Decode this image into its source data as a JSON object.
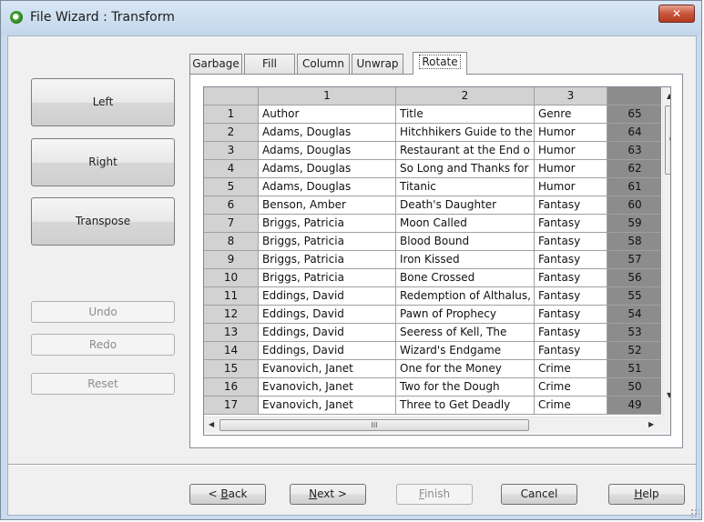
{
  "window": {
    "title": "File Wizard : Transform",
    "close_symbol": "✕"
  },
  "side_buttons": {
    "left": "Left",
    "right": "Right",
    "transpose": "Transpose"
  },
  "history_buttons": {
    "undo": "Undo",
    "redo": "Redo",
    "reset": "Reset"
  },
  "tabs": [
    {
      "label": "Garbage"
    },
    {
      "label": "Fill"
    },
    {
      "label": "Column"
    },
    {
      "label": "Unwrap"
    },
    {
      "label": "Rotate",
      "active": true
    }
  ],
  "grid": {
    "columns": [
      "1",
      "2",
      "3",
      ""
    ],
    "rows": [
      [
        "1",
        "Author",
        "Title",
        "Genre",
        "65"
      ],
      [
        "2",
        "Adams, Douglas",
        "Hitchhikers Guide to the",
        "Humor",
        "64"
      ],
      [
        "3",
        "Adams, Douglas",
        "Restaurant at the End o",
        "Humor",
        "63"
      ],
      [
        "4",
        "Adams, Douglas",
        "So Long and Thanks for",
        "Humor",
        "62"
      ],
      [
        "5",
        "Adams, Douglas",
        "Titanic",
        "Humor",
        "61"
      ],
      [
        "6",
        "Benson, Amber",
        "Death's Daughter",
        "Fantasy",
        "60"
      ],
      [
        "7",
        "Briggs, Patricia",
        "Moon Called",
        "Fantasy",
        "59"
      ],
      [
        "8",
        "Briggs, Patricia",
        "Blood Bound",
        "Fantasy",
        "58"
      ],
      [
        "9",
        "Briggs, Patricia",
        "Iron Kissed",
        "Fantasy",
        "57"
      ],
      [
        "10",
        "Briggs, Patricia",
        "Bone Crossed",
        "Fantasy",
        "56"
      ],
      [
        "11",
        "Eddings, David",
        "Redemption of Althalus,",
        "Fantasy",
        "55"
      ],
      [
        "12",
        "Eddings, David",
        "Pawn of Prophecy",
        "Fantasy",
        "54"
      ],
      [
        "13",
        "Eddings, David",
        "Seeress of Kell, The",
        "Fantasy",
        "53"
      ],
      [
        "14",
        "Eddings, David",
        "Wizard's Endgame",
        "Fantasy",
        "52"
      ],
      [
        "15",
        "Evanovich, Janet",
        "One for the Money",
        "Crime",
        "51"
      ],
      [
        "16",
        "Evanovich, Janet",
        "Two for the Dough",
        "Crime",
        "50"
      ],
      [
        "17",
        "Evanovich, Janet",
        "Three to Get Deadly",
        "Crime",
        "49"
      ]
    ]
  },
  "scrollbar": {
    "h_grip": "III",
    "v_grip": "≡"
  },
  "footer_buttons": {
    "back": {
      "accel": "B",
      "rest": "ack",
      "prefix": "< "
    },
    "next": {
      "accel": "N",
      "rest": "ext >"
    },
    "finish": {
      "accel": "F",
      "rest": "inish"
    },
    "cancel": "Cancel",
    "help": {
      "accel": "H",
      "rest": "elp"
    }
  }
}
